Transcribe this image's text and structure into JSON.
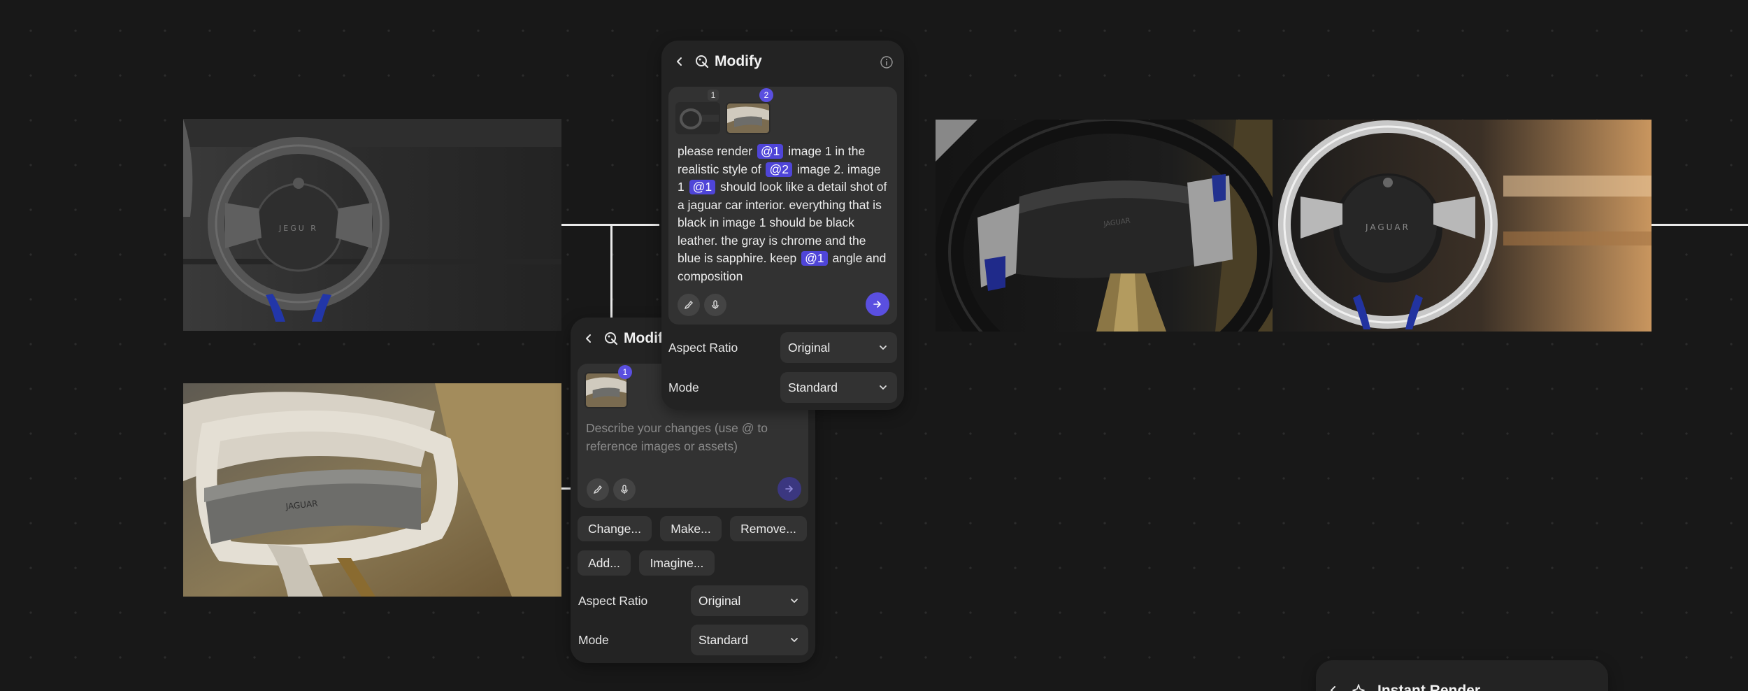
{
  "panel_main": {
    "title": "Modify",
    "thumb_badges": [
      "1",
      "2"
    ],
    "prompt_segments": [
      {
        "t": "please render "
      },
      {
        "chip": "@1"
      },
      {
        "t": " image 1 in the realistic style of "
      },
      {
        "chip": "@2"
      },
      {
        "t": " image 2. image 1 "
      },
      {
        "chip": "@1"
      },
      {
        "t": " should look like a detail shot of a jaguar car interior. everything that is black in image 1 should be black leather. the gray is chrome and the blue is sapphire. keep "
      },
      {
        "chip": "@1"
      },
      {
        "t": " angle and composition"
      }
    ],
    "aspect_label": "Aspect Ratio",
    "aspect_value": "Original",
    "mode_label": "Mode",
    "mode_value": "Standard"
  },
  "panel_second": {
    "title": "Modify",
    "thumb_badge": "1",
    "placeholder": "Describe your changes (use @ to reference images or assets)",
    "suggestions_row1": [
      "Change...",
      "Make...",
      "Remove..."
    ],
    "suggestions_row2": [
      "Add...",
      "Imagine..."
    ],
    "aspect_label": "Aspect Ratio",
    "aspect_value": "Original",
    "mode_label": "Mode",
    "mode_value": "Standard"
  },
  "panel_third": {
    "title": "Instant Render"
  },
  "icons": {
    "back": "chevron-left-icon",
    "modify": "modify-brush-icon",
    "info": "info-icon",
    "brush": "brush-tool-icon",
    "mic": "microphone-icon",
    "send": "arrow-right-icon",
    "dropdown": "chevron-down-icon",
    "sparkle": "sparkle-icon"
  },
  "colors": {
    "accent": "#5a4fe0",
    "background": "#181818",
    "panel": "#232323"
  }
}
